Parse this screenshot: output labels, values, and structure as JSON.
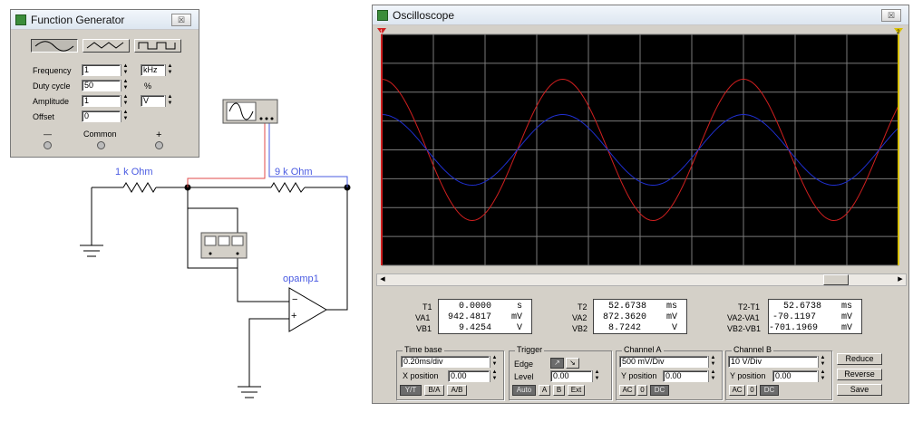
{
  "fg": {
    "title": "Function Generator",
    "close": "☒",
    "waveforms": [
      "sine-wave",
      "triangle-wave",
      "square-wave"
    ],
    "frequency_label": "Frequency",
    "frequency_value": "1",
    "frequency_unit": "kHz",
    "duty_label": "Duty cycle",
    "duty_value": "50",
    "duty_unit": "%",
    "amplitude_label": "Amplitude",
    "amplitude_value": "1",
    "amplitude_unit": "V",
    "offset_label": "Offset",
    "offset_value": "0",
    "minus": "—",
    "common": "Common",
    "plus": "+"
  },
  "circuit": {
    "r1_label": "1 k Ohm",
    "r2_label": "9 k Ohm",
    "opamp_label": "opamp1",
    "minus": "−",
    "plus": "+",
    "wire_red": "#e24a4a",
    "wire_blue": "#4a5be2"
  },
  "scope": {
    "title": "Oscilloscope",
    "close": "☒",
    "readouts": {
      "t1_label": "T1",
      "t1_value": "0.0000",
      "t1_unit": "s",
      "va1_label": "VA1",
      "va1_value": "942.4817",
      "va1_unit": "mV",
      "vb1_label": "VB1",
      "vb1_value": "9.4254",
      "vb1_unit": "V",
      "t2_label": "T2",
      "t2_value": "52.6738",
      "t2_unit": "ms",
      "va2_label": "VA2",
      "va2_value": "872.3620",
      "va2_unit": "mV",
      "vb2_label": "VB2",
      "vb2_value": "8.7242",
      "vb2_unit": "V",
      "dt_label": "T2-T1",
      "dt_value": "52.6738",
      "dt_unit": "ms",
      "dva_label": "VA2-VA1",
      "dva_value": "-70.1197",
      "dva_unit": "mV",
      "dvb_label": "VB2-VB1",
      "dvb_value": "-701.1969",
      "dvb_unit": "mV"
    },
    "timebase": {
      "title": "Time base",
      "value": "0.20ms/div",
      "xpos_label": "X position",
      "xpos_value": "0.00",
      "yt": "Y/T",
      "ba": "B/A",
      "ab": "A/B"
    },
    "trigger": {
      "title": "Trigger",
      "edge_label": "Edge",
      "rising": "↗",
      "falling": "↘",
      "level_label": "Level",
      "level_value": "0.00",
      "auto": "Auto",
      "a": "A",
      "b": "B",
      "ext": "Ext"
    },
    "channel_a": {
      "title": "Channel A",
      "value": "500 mV/Div",
      "ypos_label": "Y position",
      "ypos_value": "0.00",
      "ac": "AC",
      "zero": "0",
      "dc": "DC"
    },
    "channel_b": {
      "title": "Channel B",
      "value": "10 V/Div",
      "ypos_label": "Y position",
      "ypos_value": "0.00",
      "ac": "AC",
      "zero": "0",
      "dc": "DC"
    },
    "buttons": {
      "reduce": "Reduce",
      "reverse": "Reverse",
      "save": "Save"
    },
    "marker1": "1",
    "marker2": "2",
    "trace_colors": {
      "a": "#1f2fd0",
      "b": "#d01f1f",
      "grid": "#7a7a7a",
      "screen": "#000000"
    }
  }
}
